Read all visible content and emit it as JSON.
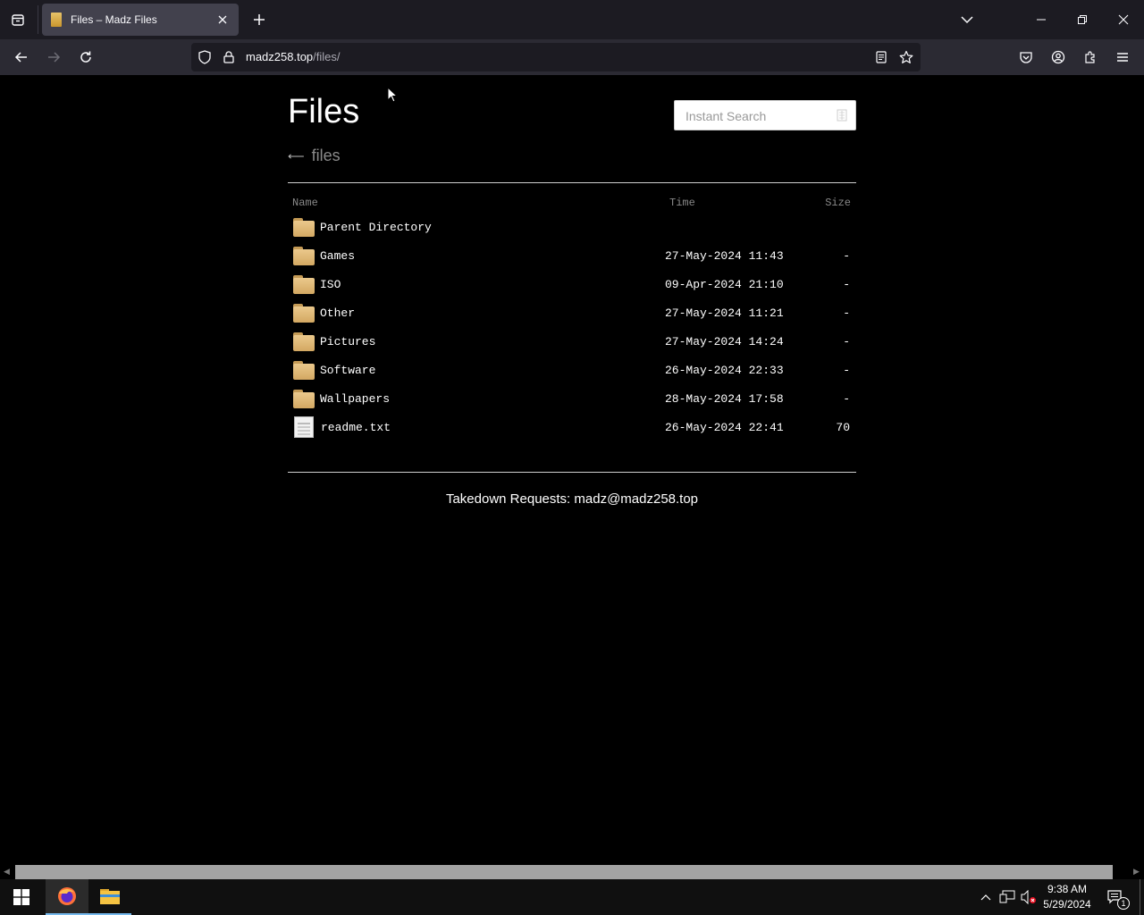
{
  "browser": {
    "tab": {
      "title": "Files – Madz Files"
    },
    "url": {
      "host": "madz258.top",
      "path": "/files/"
    }
  },
  "page": {
    "title": "Files",
    "search": {
      "placeholder": "Instant Search"
    },
    "breadcrumb": {
      "arrow": "⟵",
      "label": "files"
    },
    "columns": {
      "name": "Name",
      "time": "Time",
      "size": "Size"
    },
    "rows": [
      {
        "type": "parent",
        "name": "Parent Directory",
        "time": "",
        "size": ""
      },
      {
        "type": "folder",
        "name": "Games",
        "time": "27-May-2024 11:43",
        "size": "-"
      },
      {
        "type": "folder",
        "name": "ISO",
        "time": "09-Apr-2024 21:10",
        "size": "-"
      },
      {
        "type": "folder",
        "name": "Other",
        "time": "27-May-2024 11:21",
        "size": "-"
      },
      {
        "type": "folder",
        "name": "Pictures",
        "time": "27-May-2024 14:24",
        "size": "-"
      },
      {
        "type": "folder",
        "name": "Software",
        "time": "26-May-2024 22:33",
        "size": "-"
      },
      {
        "type": "folder",
        "name": "Wallpapers",
        "time": "28-May-2024 17:58",
        "size": "-"
      },
      {
        "type": "file",
        "name": "readme.txt",
        "time": "26-May-2024 22:41",
        "size": "70"
      }
    ],
    "footer": "Takedown Requests: madz@madz258.top"
  },
  "taskbar": {
    "time": "9:38 AM",
    "date": "5/29/2024",
    "notification_count": "1"
  }
}
